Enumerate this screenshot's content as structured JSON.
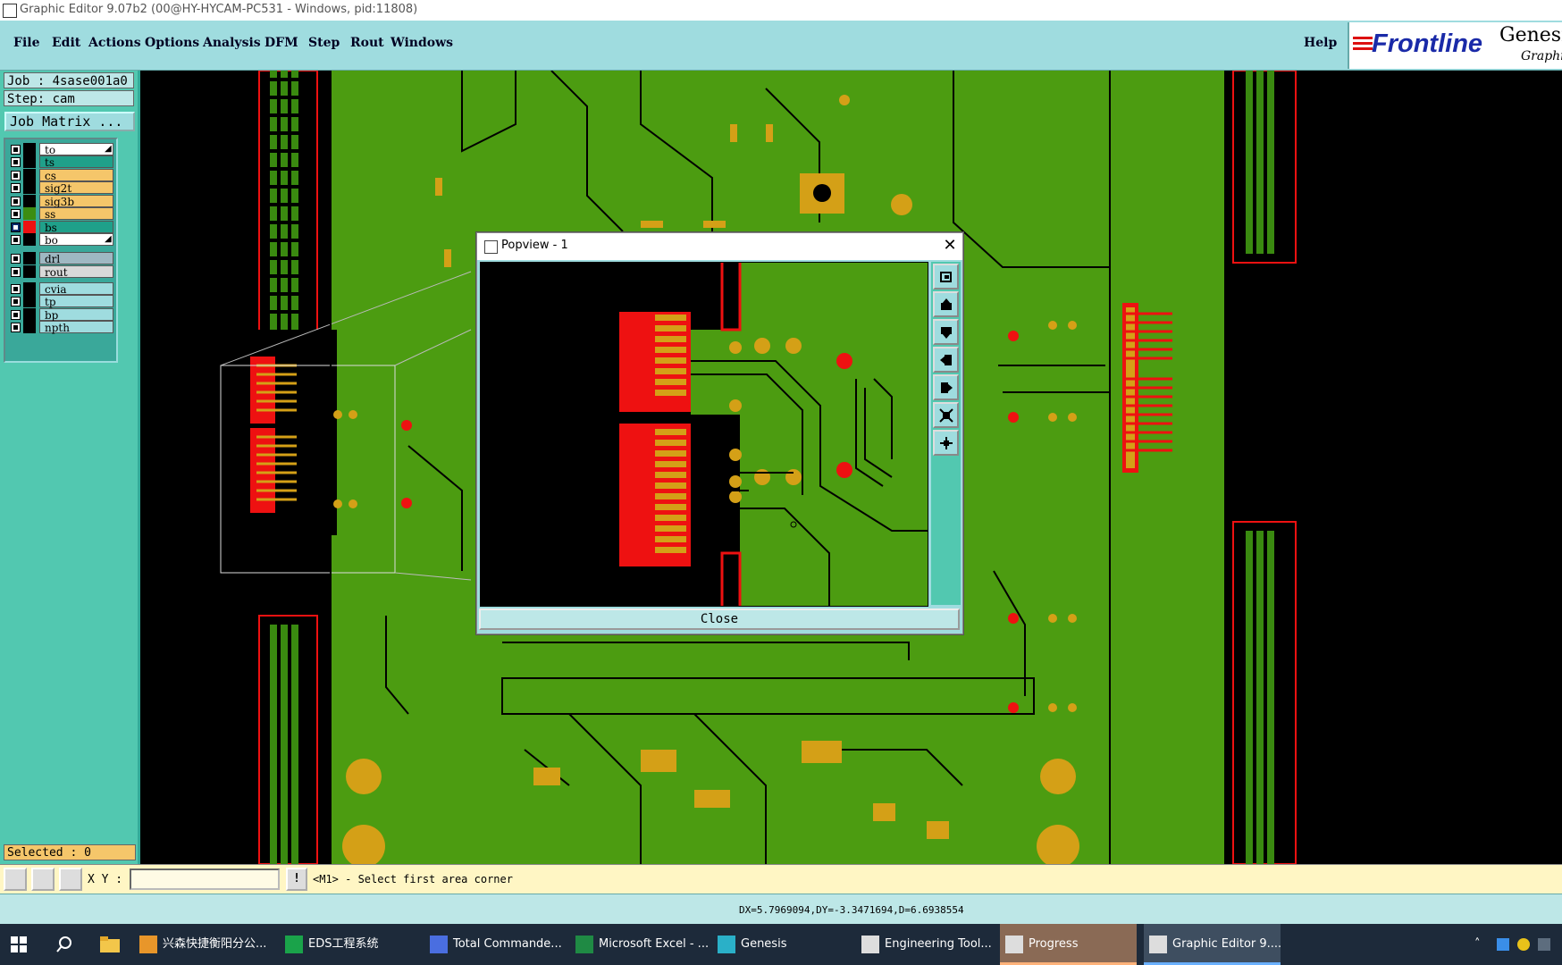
{
  "window": {
    "title": "Graphic Editor 9.07b2 (00@HY-HYCAM-PC531 - Windows, pid:11808)"
  },
  "menu": {
    "items": [
      "File",
      "Edit",
      "Actions",
      "Options",
      "Analysis",
      "DFM",
      "Step",
      "Rout",
      "Windows"
    ],
    "help": "Help"
  },
  "brand": {
    "logo": "Frontline",
    "product": "Genesi",
    "subtitle": "Graphic"
  },
  "left_panel": {
    "job": "Job : 4sase001a0",
    "step": "Step: cam",
    "job_matrix_button": "Job Matrix ...",
    "layers": [
      {
        "name": "to",
        "bg": "#ffffff",
        "swatch": "#000000",
        "checked": false,
        "has_arrow": true
      },
      {
        "name": "ts",
        "bg": "#1fa08a",
        "swatch": "#000000",
        "checked": false,
        "has_arrow": false
      },
      {
        "name": "cs",
        "bg": "#f5c66a",
        "swatch": "#000000",
        "checked": false,
        "has_arrow": false
      },
      {
        "name": "sig2t",
        "bg": "#f5c66a",
        "swatch": "#000000",
        "checked": false,
        "has_arrow": false
      },
      {
        "name": "sig3b",
        "bg": "#f5c66a",
        "swatch": "#000000",
        "checked": false,
        "has_arrow": false
      },
      {
        "name": "ss",
        "bg": "#f5c66a",
        "swatch": "#3c8d12",
        "checked": false,
        "has_arrow": false
      },
      {
        "name": "bs",
        "bg": "#1fa08a",
        "swatch": "#ee1111",
        "checked": true,
        "has_arrow": false
      },
      {
        "name": "bo",
        "bg": "#ffffff",
        "swatch": "#000000",
        "checked": false,
        "has_arrow": true
      },
      {
        "name": "drl",
        "bg": "#9fb8c2",
        "swatch": "#000000",
        "checked": false,
        "has_arrow": false
      },
      {
        "name": "rout",
        "bg": "#d9d9d9",
        "swatch": "#000000",
        "checked": false,
        "has_arrow": false
      },
      {
        "name": "cvia",
        "bg": "#9fdcdf",
        "swatch": "#000000",
        "checked": false,
        "has_arrow": false
      },
      {
        "name": "tp",
        "bg": "#9fdcdf",
        "swatch": "#000000",
        "checked": false,
        "has_arrow": false
      },
      {
        "name": "bp",
        "bg": "#9fdcdf",
        "swatch": "#000000",
        "checked": false,
        "has_arrow": false
      },
      {
        "name": "npth",
        "bg": "#9fdcdf",
        "swatch": "#000000",
        "checked": false,
        "has_arrow": false
      }
    ],
    "selected": "Selected : 0"
  },
  "popview": {
    "title": "Popview - 1",
    "close_x": "✕",
    "close_button": "Close",
    "tool_icons": [
      "zoom-home-icon",
      "pan-up-icon",
      "pan-down-icon",
      "pan-left-icon",
      "pan-right-icon",
      "zoom-out-icon",
      "zoom-in-icon"
    ]
  },
  "command_bar": {
    "xy_label": "X Y :",
    "xy_value": "",
    "prompt": "<M1> - Select first area corner",
    "info_button": "!"
  },
  "status": {
    "text": "DX=5.7969094,DY=-3.3471694,D=6.6938554"
  },
  "taskbar": {
    "items": [
      {
        "label": "兴森快捷衡阳分公...",
        "icon": "browser-icon"
      },
      {
        "label": "EDS工程系统",
        "icon": "eds-icon"
      },
      {
        "label": "Total Commande...",
        "icon": "disk-icon"
      },
      {
        "label": "Microsoft Excel - ...",
        "icon": "excel-icon"
      },
      {
        "label": "Genesis",
        "icon": "genesis-icon"
      },
      {
        "label": "Engineering Tool...",
        "icon": "tool-icon"
      },
      {
        "label": "Progress",
        "icon": "progress-icon"
      },
      {
        "label": "Graphic Editor 9....",
        "icon": "editor-icon"
      }
    ]
  },
  "colors": {
    "panel_teal": "#52c8b0",
    "menu_cyan": "#9fdcdf",
    "board_green": "#4c9c11",
    "pad_gold": "#d4a017",
    "copper_red": "#ee1111"
  }
}
